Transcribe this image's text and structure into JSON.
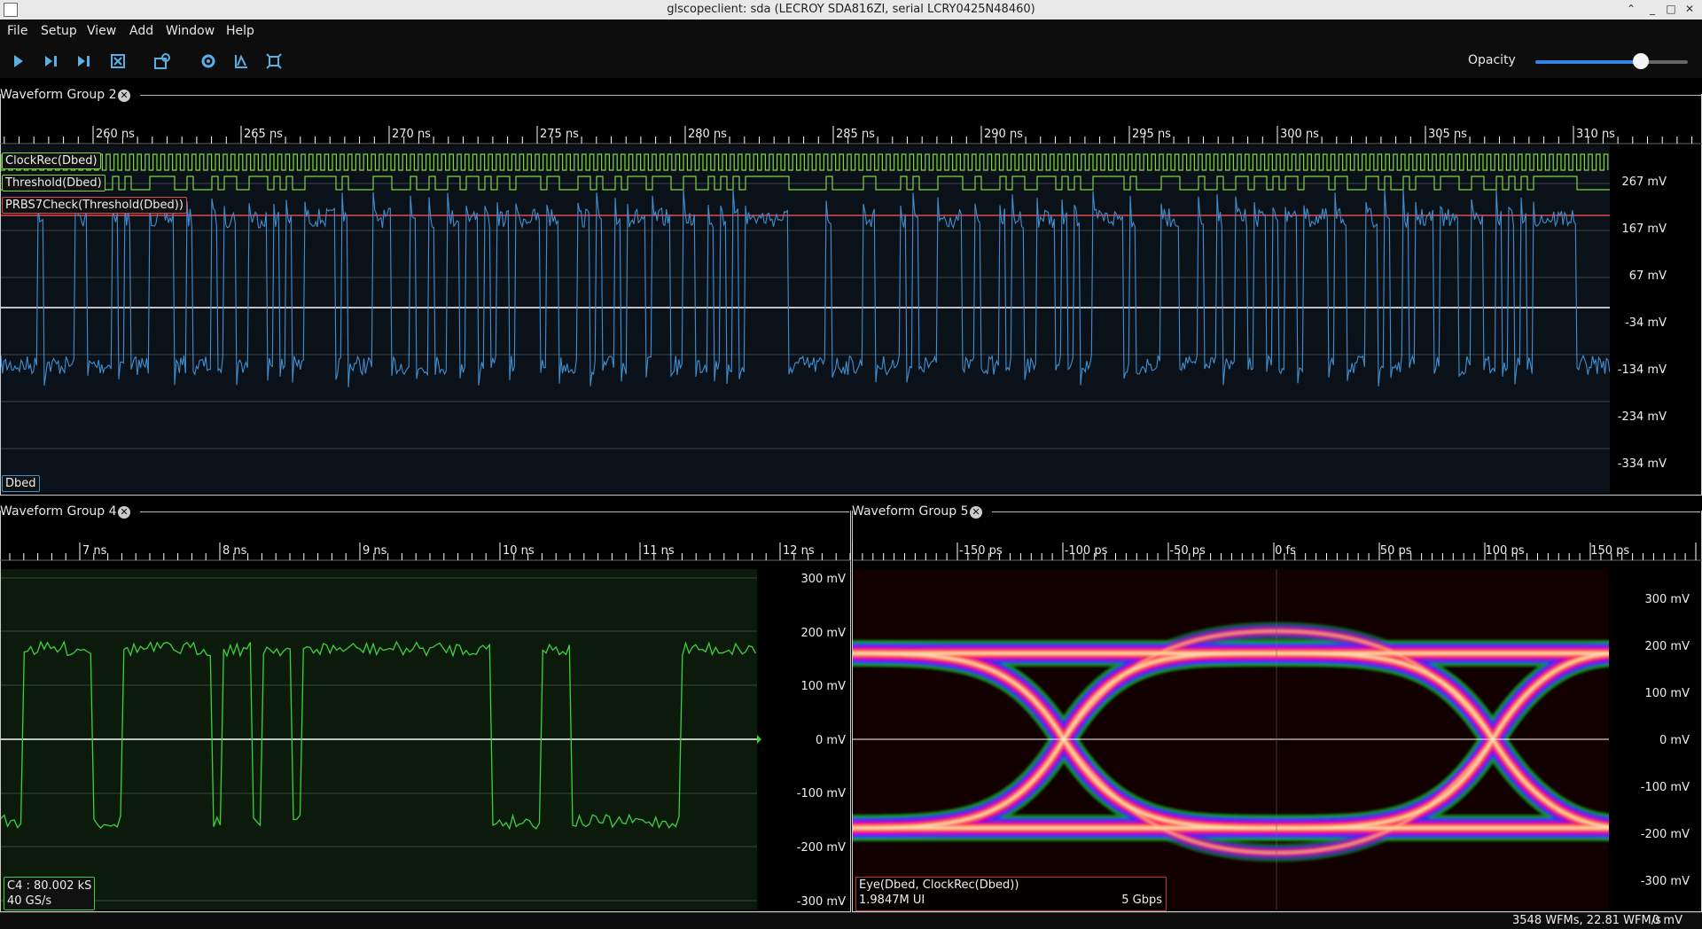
{
  "window": {
    "title": "glscopeclient: sda (LECROY SDA816ZI, serial LCRY0425N48460)"
  },
  "menu": [
    "File",
    "Setup",
    "View",
    "Add",
    "Window",
    "Help"
  ],
  "toolbar": {
    "buttons": [
      "start-trigger-icon",
      "single-trigger-icon",
      "force-trigger-icon",
      "stop-trigger-icon",
      "history-icon",
      "refresh-icon",
      "clear-sweeps-icon",
      "fullscreen-icon"
    ],
    "opacity_label": "Opacity",
    "opacity_value": 0.69
  },
  "group2": {
    "title": "Waveform Group 2",
    "timeline": [
      "260 ns",
      "265 ns",
      "270 ns",
      "275 ns",
      "280 ns",
      "285 ns",
      "290 ns",
      "295 ns",
      "300 ns",
      "305 ns",
      "310 ns"
    ],
    "yticks": [
      "267 mV",
      "167 mV",
      "67 mV",
      "-34 mV",
      "-134 mV",
      "-234 mV",
      "-334 mV"
    ],
    "labels": {
      "clockrec": "ClockRec(Dbed)",
      "threshold": "Threshold(Dbed)",
      "prbs": "PRBS7Check(Threshold(Dbed))",
      "channel": "Dbed"
    },
    "colors": {
      "digital": "#7fd63f",
      "analog": "#3f8fd0",
      "prbs": "#e04a4a"
    }
  },
  "group4": {
    "title": "Waveform Group 4",
    "timeline": [
      "7 ns",
      "8 ns",
      "9 ns",
      "10 ns",
      "11 ns",
      "12 ns"
    ],
    "yticks": [
      "300 mV",
      "200 mV",
      "100 mV",
      "0 mV",
      "-100 mV",
      "-200 mV",
      "-300 mV"
    ],
    "info_line1": "C4 : 80.002 kS",
    "info_line2": "40 GS/s",
    "color": "#3fd03f"
  },
  "group5": {
    "title": "Waveform Group 5",
    "timeline": [
      "-150 ps",
      "-100 ps",
      "-50 ps",
      "0 fs",
      "50 ps",
      "100 ps",
      "150 ps"
    ],
    "yticks": [
      "300 mV",
      "200 mV",
      "100 mV",
      "0 mV",
      "-100 mV",
      "-200 mV",
      "-300 mV"
    ],
    "info_line1": "Eye(Dbed, ClockRec(Dbed))",
    "info_line2": "1.9847M UI",
    "info_rate": "5 Gbps"
  },
  "status": {
    "wfms": "3548 WFMs, 22.81 WFM/s",
    "offset": "0 mV"
  }
}
